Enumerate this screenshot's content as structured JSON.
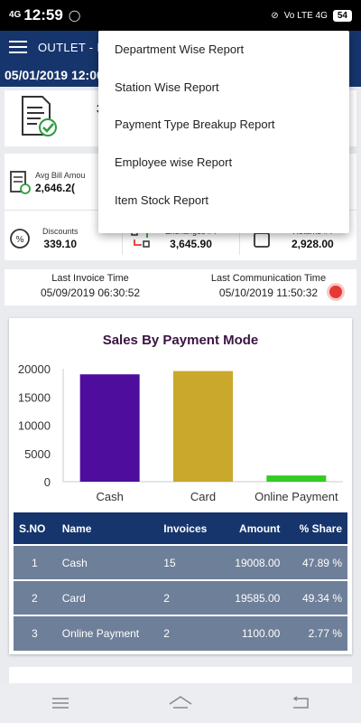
{
  "status_bar": {
    "network": "4G",
    "time": "12:59",
    "right_network": "Vo LTE 4G",
    "battery": "54"
  },
  "app_bar": {
    "title": "OUTLET - IRF"
  },
  "date_bar": {
    "text": "05/01/2019 12:00"
  },
  "summary": {
    "partial_value": "3"
  },
  "stats": {
    "avg_bill_label": "Avg Bill Amou",
    "avg_bill_value": "2,646.2(",
    "discounts_label": "Discounts",
    "discounts_value": "339.10",
    "exchanges_label": "Exchanges #4",
    "exchanges_value": "3,645.90",
    "returns_label": "Returns #4",
    "returns_value": "2,928.00"
  },
  "times": {
    "last_invoice_label": "Last Invoice Time",
    "last_invoice_value": "05/09/2019 06:30:52",
    "last_comm_label": "Last Communication Time",
    "last_comm_value": "05/10/2019 11:50:32"
  },
  "chart_data": {
    "type": "bar",
    "title": "Sales By Payment Mode",
    "categories": [
      "Cash",
      "Card",
      "Online Payment"
    ],
    "values": [
      19008.0,
      19585.0,
      1100.0
    ],
    "colors": [
      "#4f0d9e",
      "#c9a82c",
      "#33cc22"
    ],
    "ylim": [
      0,
      20000
    ],
    "yticks": [
      "0",
      "5000",
      "10000",
      "15000",
      "20000"
    ],
    "xlabel": "",
    "ylabel": ""
  },
  "table": {
    "headers": [
      "S.NO",
      "Name",
      "Invoices",
      "Amount",
      "% Share"
    ],
    "rows": [
      [
        "1",
        "Cash",
        "15",
        "19008.00",
        "47.89 %"
      ],
      [
        "2",
        "Card",
        "2",
        "19585.00",
        "49.34 %"
      ],
      [
        "3",
        "Online Payment",
        "2",
        "1100.00",
        "2.77 %"
      ]
    ]
  },
  "menu": {
    "items": [
      "Department Wise Report",
      "Station Wise Report",
      "Payment Type Breakup Report",
      "Employee wise Report",
      "Item Stock Report"
    ]
  }
}
